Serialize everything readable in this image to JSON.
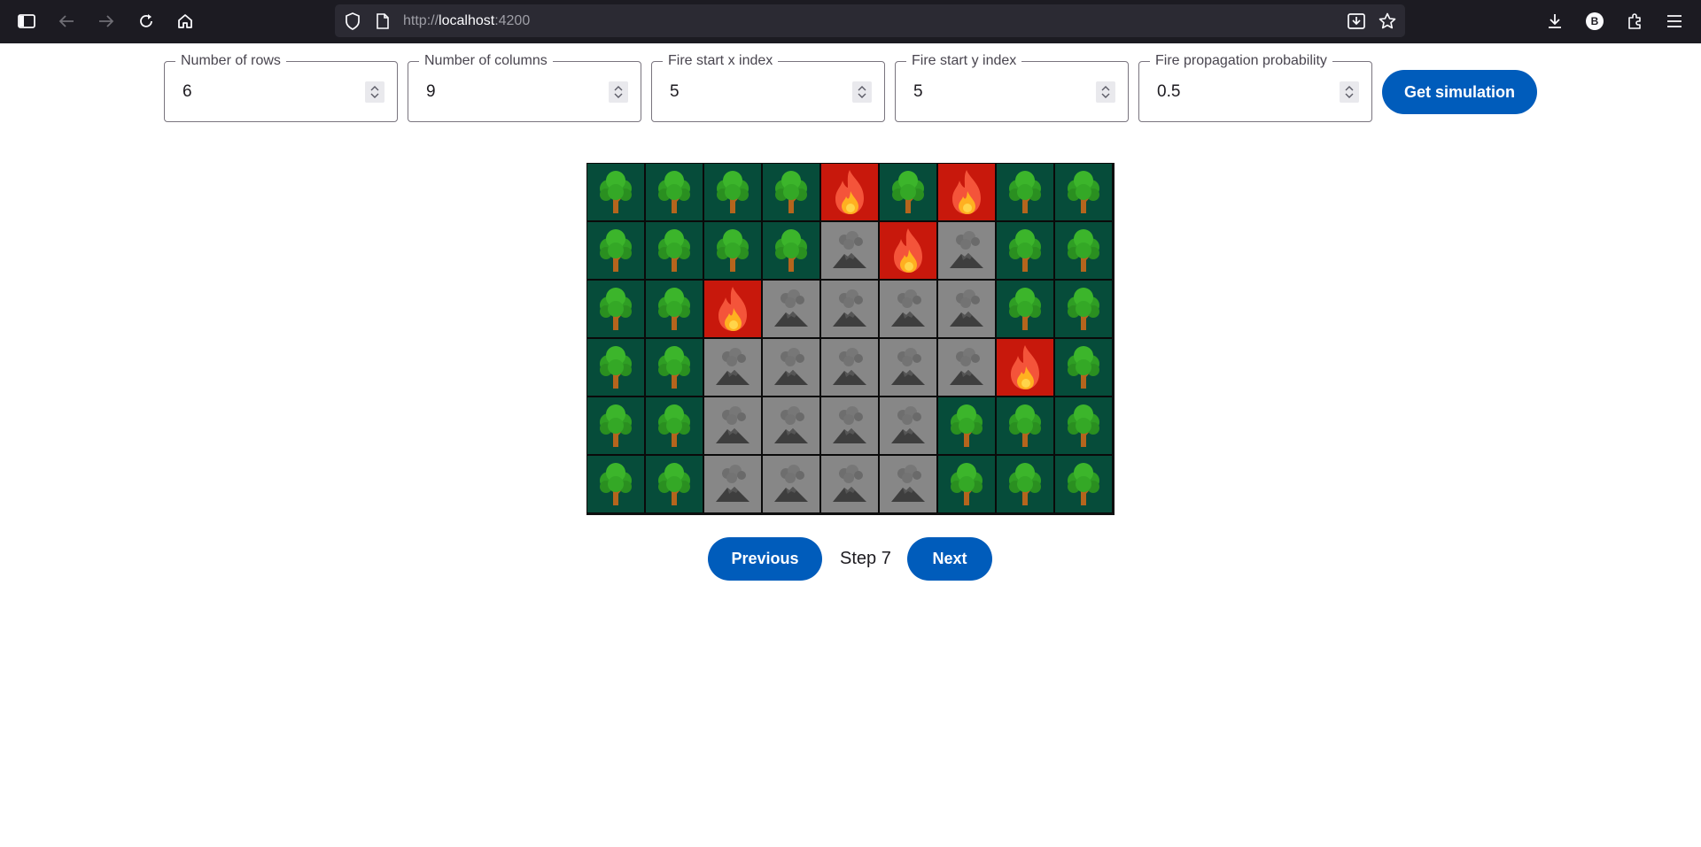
{
  "browser": {
    "url_scheme": "http://",
    "url_host": "localhost",
    "url_port": ":4200",
    "profile_initial": "B"
  },
  "form": {
    "fields": [
      {
        "label": "Number of rows",
        "value": "6"
      },
      {
        "label": "Number of columns",
        "value": "9"
      },
      {
        "label": "Fire start x index",
        "value": "5"
      },
      {
        "label": "Fire start y index",
        "value": "5"
      },
      {
        "label": "Fire propagation probability",
        "value": "0.5"
      }
    ],
    "submit_label": "Get simulation"
  },
  "grid": {
    "rows": [
      [
        "tree",
        "tree",
        "tree",
        "tree",
        "fire",
        "tree",
        "fire",
        "tree",
        "tree"
      ],
      [
        "tree",
        "tree",
        "tree",
        "tree",
        "ash",
        "fire",
        "ash",
        "tree",
        "tree"
      ],
      [
        "tree",
        "tree",
        "fire",
        "ash",
        "ash",
        "ash",
        "ash",
        "tree",
        "tree"
      ],
      [
        "tree",
        "tree",
        "ash",
        "ash",
        "ash",
        "ash",
        "ash",
        "fire",
        "tree"
      ],
      [
        "tree",
        "tree",
        "ash",
        "ash",
        "ash",
        "ash",
        "tree",
        "tree",
        "tree"
      ],
      [
        "tree",
        "tree",
        "ash",
        "ash",
        "ash",
        "ash",
        "tree",
        "tree",
        "tree"
      ]
    ],
    "colors": {
      "tree": "#064c3a",
      "fire": "#c8180c",
      "ash": "#878787"
    },
    "icons": {
      "tree": "tree-icon",
      "fire": "fire-icon",
      "ash": "volcano-icon"
    }
  },
  "stepper": {
    "previous_label": "Previous",
    "step_label": "Step 7",
    "next_label": "Next"
  }
}
